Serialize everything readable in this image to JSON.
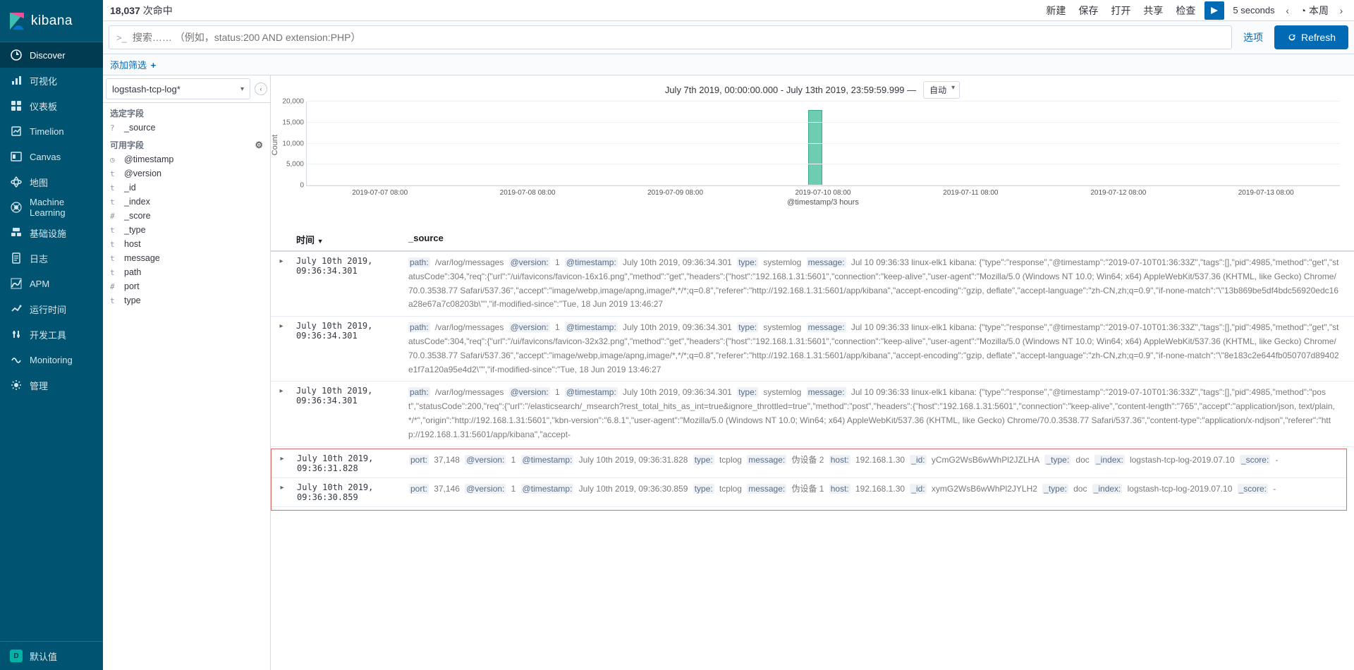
{
  "brand": "kibana",
  "nav": {
    "items": [
      {
        "label": "Discover",
        "active": true
      },
      {
        "label": "可视化"
      },
      {
        "label": "仪表板"
      },
      {
        "label": "Timelion"
      },
      {
        "label": "Canvas"
      },
      {
        "label": "地图"
      },
      {
        "label": "Machine Learning"
      },
      {
        "label": "基础设施"
      },
      {
        "label": "日志"
      },
      {
        "label": "APM"
      },
      {
        "label": "运行时间"
      },
      {
        "label": "开发工具"
      },
      {
        "label": "Monitoring"
      },
      {
        "label": "管理"
      }
    ],
    "bottom_label": "默认值"
  },
  "topbar": {
    "hits": "18,037",
    "hits_suffix": "次命中",
    "links": [
      "新建",
      "保存",
      "打开",
      "共享",
      "检查"
    ],
    "auto": "5 seconds",
    "range": "◔ 本周"
  },
  "search": {
    "placeholder": "搜索…… （例如，status:200 AND extension:PHP）",
    "options": "选项",
    "refresh": "Refresh"
  },
  "filter": {
    "add": "添加筛选"
  },
  "fields": {
    "index": "logstash-tcp-log*",
    "selected_title": "选定字段",
    "selected": [
      "_source"
    ],
    "available_title": "可用字段",
    "available": [
      {
        "t": "◷",
        "n": "@timestamp"
      },
      {
        "t": "t",
        "n": "@version"
      },
      {
        "t": "t",
        "n": "_id"
      },
      {
        "t": "t",
        "n": "_index"
      },
      {
        "t": "#",
        "n": "_score"
      },
      {
        "t": "t",
        "n": "_type"
      },
      {
        "t": "t",
        "n": "host"
      },
      {
        "t": "t",
        "n": "message"
      },
      {
        "t": "t",
        "n": "path"
      },
      {
        "t": "#",
        "n": "port"
      },
      {
        "t": "t",
        "n": "type"
      }
    ]
  },
  "chart": {
    "range": "July 7th 2019, 00:00:00.000 - July 13th 2019, 23:59:59.999 —",
    "scale": "自动",
    "ylabel": "Count",
    "xlabel": "@timestamp/3 hours",
    "yticks": [
      "0",
      "5,000",
      "10,000",
      "15,000",
      "20,000"
    ],
    "xticks": [
      "2019-07-07 08:00",
      "2019-07-08 08:00",
      "2019-07-09 08:00",
      "2019-07-10 08:00",
      "2019-07-11 08:00",
      "2019-07-12 08:00",
      "2019-07-13 08:00"
    ]
  },
  "chart_data": {
    "type": "bar",
    "categories": [
      "2019-07-07 08:00",
      "2019-07-08 08:00",
      "2019-07-09 08:00",
      "2019-07-10 08:00",
      "2019-07-11 08:00",
      "2019-07-12 08:00",
      "2019-07-13 08:00"
    ],
    "series": [
      {
        "name": "Count",
        "values": [
          0,
          0,
          0,
          18037,
          0,
          0,
          0
        ]
      }
    ],
    "title": "",
    "xlabel": "@timestamp/3 hours",
    "ylabel": "Count",
    "ylim": [
      0,
      20000
    ]
  },
  "dochdr": {
    "time": "时间",
    "source": "_source"
  },
  "docs": [
    {
      "time": "July 10th 2019, 09:36:34.301",
      "fields": [
        [
          "path:",
          "/var/log/messages"
        ],
        [
          "@version:",
          "1"
        ],
        [
          "@timestamp:",
          "July 10th 2019, 09:36:34.301"
        ],
        [
          "type:",
          "systemlog"
        ],
        [
          "message:",
          "Jul 10 09:36:33 linux-elk1 kibana: {\"type\":\"response\",\"@timestamp\":\"2019-07-10T01:36:33Z\",\"tags\":[],\"pid\":4985,\"method\":\"get\",\"statusCode\":304,\"req\":{\"url\":\"/ui/favicons/favicon-16x16.png\",\"method\":\"get\",\"headers\":{\"host\":\"192.168.1.31:5601\",\"connection\":\"keep-alive\",\"user-agent\":\"Mozilla/5.0 (Windows NT 10.0; Win64; x64) AppleWebKit/537.36 (KHTML, like Gecko) Chrome/70.0.3538.77 Safari/537.36\",\"accept\":\"image/webp,image/apng,image/*,*/*;q=0.8\",\"referer\":\"http://192.168.1.31:5601/app/kibana\",\"accept-encoding\":\"gzip, deflate\",\"accept-language\":\"zh-CN,zh;q=0.9\",\"if-none-match\":\"\\\"13b869be5df4bdc56920edc16a28e67a7c08203b\\\"\",\"if-modified-since\":\"Tue, 18 Jun 2019 13:46:27"
        ]
      ]
    },
    {
      "time": "July 10th 2019, 09:36:34.301",
      "fields": [
        [
          "path:",
          "/var/log/messages"
        ],
        [
          "@version:",
          "1"
        ],
        [
          "@timestamp:",
          "July 10th 2019, 09:36:34.301"
        ],
        [
          "type:",
          "systemlog"
        ],
        [
          "message:",
          "Jul 10 09:36:33 linux-elk1 kibana: {\"type\":\"response\",\"@timestamp\":\"2019-07-10T01:36:33Z\",\"tags\":[],\"pid\":4985,\"method\":\"get\",\"statusCode\":304,\"req\":{\"url\":\"/ui/favicons/favicon-32x32.png\",\"method\":\"get\",\"headers\":{\"host\":\"192.168.1.31:5601\",\"connection\":\"keep-alive\",\"user-agent\":\"Mozilla/5.0 (Windows NT 10.0; Win64; x64) AppleWebKit/537.36 (KHTML, like Gecko) Chrome/70.0.3538.77 Safari/537.36\",\"accept\":\"image/webp,image/apng,image/*,*/*;q=0.8\",\"referer\":\"http://192.168.1.31:5601/app/kibana\",\"accept-encoding\":\"gzip, deflate\",\"accept-language\":\"zh-CN,zh;q=0.9\",\"if-none-match\":\"\\\"8e183c2e644fb050707d89402e1f7a120a95e4d2\\\"\",\"if-modified-since\":\"Tue, 18 Jun 2019 13:46:27"
        ]
      ]
    },
    {
      "time": "July 10th 2019, 09:36:34.301",
      "fields": [
        [
          "path:",
          "/var/log/messages"
        ],
        [
          "@version:",
          "1"
        ],
        [
          "@timestamp:",
          "July 10th 2019, 09:36:34.301"
        ],
        [
          "type:",
          "systemlog"
        ],
        [
          "message:",
          "Jul 10 09:36:33 linux-elk1 kibana: {\"type\":\"response\",\"@timestamp\":\"2019-07-10T01:36:33Z\",\"tags\":[],\"pid\":4985,\"method\":\"post\",\"statusCode\":200,\"req\":{\"url\":\"/elasticsearch/_msearch?rest_total_hits_as_int=true&ignore_throttled=true\",\"method\":\"post\",\"headers\":{\"host\":\"192.168.1.31:5601\",\"connection\":\"keep-alive\",\"content-length\":\"765\",\"accept\":\"application/json, text/plain, */*\",\"origin\":\"http://192.168.1.31:5601\",\"kbn-version\":\"6.8.1\",\"user-agent\":\"Mozilla/5.0 (Windows NT 10.0; Win64; x64) AppleWebKit/537.36 (KHTML, like Gecko) Chrome/70.0.3538.77 Safari/537.36\",\"content-type\":\"application/x-ndjson\",\"referer\":\"http://192.168.1.31:5601/app/kibana\",\"accept-"
        ]
      ]
    },
    {
      "time": "July 10th 2019, 09:36:31.828",
      "boxed": true,
      "fields": [
        [
          "port:",
          "37,148"
        ],
        [
          "@version:",
          "1"
        ],
        [
          "@timestamp:",
          "July 10th 2019, 09:36:31.828"
        ],
        [
          "type:",
          "tcplog"
        ],
        [
          "message:",
          "伪设备 2"
        ],
        [
          "host:",
          "192.168.1.30"
        ],
        [
          "_id:",
          "yCmG2WsB6wWhPl2JZLHA"
        ],
        [
          "_type:",
          "doc"
        ],
        [
          "_index:",
          "logstash-tcp-log-2019.07.10"
        ],
        [
          "_score:",
          " - "
        ]
      ]
    },
    {
      "time": "July 10th 2019, 09:36:30.859",
      "boxed": true,
      "fields": [
        [
          "port:",
          "37,146"
        ],
        [
          "@version:",
          "1"
        ],
        [
          "@timestamp:",
          "July 10th 2019, 09:36:30.859"
        ],
        [
          "type:",
          "tcplog"
        ],
        [
          "message:",
          "伪设备 1"
        ],
        [
          "host:",
          "192.168.1.30"
        ],
        [
          "_id:",
          "xymG2WsB6wWhPl2JYLH2"
        ],
        [
          "_type:",
          "doc"
        ],
        [
          "_index:",
          "logstash-tcp-log-2019.07.10"
        ],
        [
          "_score:",
          " - "
        ]
      ]
    }
  ]
}
